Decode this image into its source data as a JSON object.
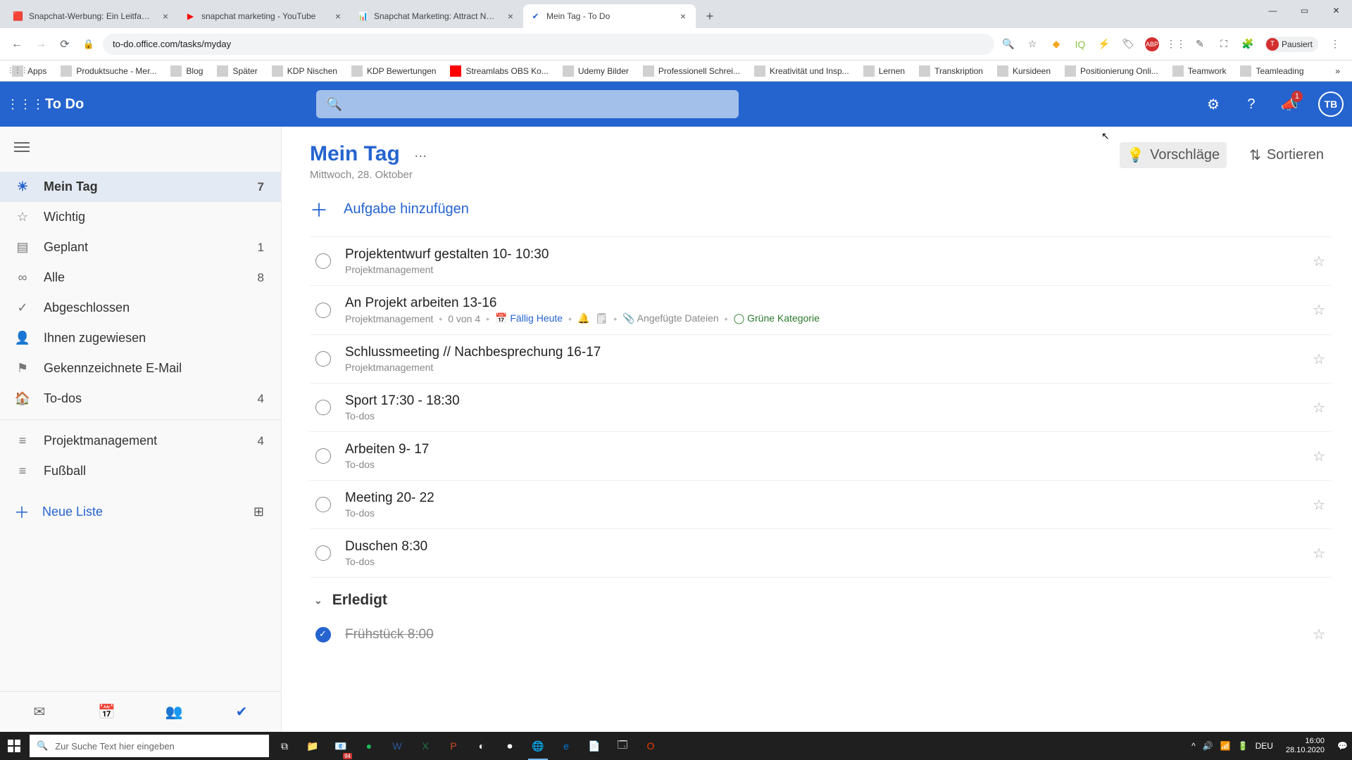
{
  "browser": {
    "tabs": [
      {
        "icon": "🟥",
        "title": "Snapchat-Werbung: Ein Leitfade..."
      },
      {
        "icon": "▶",
        "title": "snapchat marketing - YouTube"
      },
      {
        "icon": "📊",
        "title": "Snapchat Marketing: Attract New..."
      },
      {
        "icon": "✔",
        "title": "Mein Tag - To Do"
      }
    ],
    "url": "to-do.office.com/tasks/myday",
    "profile_label": "Pausiert",
    "win": {
      "min": "—",
      "max": "▭",
      "close": "✕"
    }
  },
  "bookmarks": [
    {
      "icon": "⋮⋮⋮",
      "label": "Apps"
    },
    {
      "icon": "▭",
      "label": "Produktsuche - Mer..."
    },
    {
      "icon": "▭",
      "label": "Blog"
    },
    {
      "icon": "▭",
      "label": "Später"
    },
    {
      "icon": "▭",
      "label": "KDP Nischen"
    },
    {
      "icon": "▭",
      "label": "KDP Bewertungen"
    },
    {
      "icon": "▶",
      "label": "Streamlabs OBS Ko..."
    },
    {
      "icon": "▭",
      "label": "Udemy Bilder"
    },
    {
      "icon": "▭",
      "label": "Professionell Schrei..."
    },
    {
      "icon": "▭",
      "label": "Kreativität und Insp..."
    },
    {
      "icon": "▭",
      "label": "Lernen"
    },
    {
      "icon": "▭",
      "label": "Transkription"
    },
    {
      "icon": "▭",
      "label": "Kursideen"
    },
    {
      "icon": "▭",
      "label": "Positionierung Onli..."
    },
    {
      "icon": "▭",
      "label": "Teamwork"
    },
    {
      "icon": "▭",
      "label": "Teamleading"
    }
  ],
  "app": {
    "title": "To Do",
    "notif_count": "1",
    "avatar": "TB"
  },
  "sidebar": {
    "items": [
      {
        "icon": "☀",
        "label": "Mein Tag",
        "count": "7",
        "active": true
      },
      {
        "icon": "☆",
        "label": "Wichtig"
      },
      {
        "icon": "▤",
        "label": "Geplant",
        "count": "1"
      },
      {
        "icon": "∞",
        "label": "Alle",
        "count": "8"
      },
      {
        "icon": "✓",
        "label": "Abgeschlossen"
      },
      {
        "icon": "👤",
        "label": "Ihnen zugewiesen"
      },
      {
        "icon": "⚑",
        "label": "Gekennzeichnete E-Mail"
      },
      {
        "icon": "🏠",
        "label": "To-dos",
        "count": "4"
      }
    ],
    "lists": [
      {
        "icon": "≡",
        "label": "Projektmanagement",
        "count": "4"
      },
      {
        "icon": "≡",
        "label": "Fußball"
      }
    ],
    "new_list": "Neue Liste"
  },
  "main": {
    "title": "Mein Tag",
    "subtitle": "Mittwoch, 28. Oktober",
    "suggestions": "Vorschläge",
    "sort": "Sortieren",
    "add_task": "Aufgabe hinzufügen",
    "section_done": "Erledigt",
    "tasks": [
      {
        "title": "Projektentwurf gestalten 10- 10:30",
        "sub": "Projektmanagement"
      },
      {
        "title": "An Projekt arbeiten 13-16",
        "sub_complex": true,
        "cat": "Projektmanagement",
        "progress": "0 von 4",
        "due": "Fällig Heute",
        "attach": "Angefügte Dateien",
        "green": "Grüne Kategorie"
      },
      {
        "title": "Schlussmeeting // Nachbesprechung 16-17",
        "sub": "Projektmanagement"
      },
      {
        "title": "Sport 17:30 - 18:30",
        "sub": "To-dos"
      },
      {
        "title": "Arbeiten 9- 17",
        "sub": "To-dos"
      },
      {
        "title": "Meeting 20- 22",
        "sub": "To-dos"
      },
      {
        "title": "Duschen 8:30",
        "sub": "To-dos"
      }
    ],
    "done_tasks": [
      {
        "title": "Frühstück 8:00"
      }
    ]
  },
  "taskbar": {
    "search_placeholder": "Zur Suche Text hier eingeben",
    "lang": "DEU",
    "time": "16:00",
    "date": "28.10.2020"
  }
}
